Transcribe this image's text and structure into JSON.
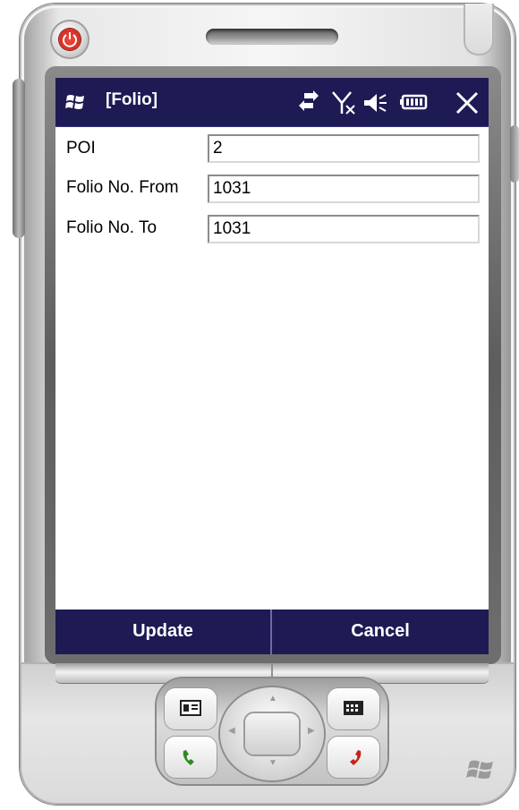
{
  "window": {
    "title": "[Folio]"
  },
  "status_icons": [
    "windows-start-icon",
    "sync-icon",
    "signal-off-icon",
    "volume-icon",
    "battery-icon",
    "close-icon"
  ],
  "form": {
    "poi": {
      "label": "POI",
      "value": "2"
    },
    "folio_from": {
      "label": "Folio No. From",
      "value": "1031"
    },
    "folio_to": {
      "label": "Folio No. To",
      "value": "1031"
    }
  },
  "softkeys": {
    "left": "Update",
    "right": "Cancel"
  },
  "hardware_keys": [
    "power-icon",
    "contacts-icon",
    "calendar-icon",
    "call-icon",
    "end-call-icon",
    "dpad",
    "windows-logo-icon"
  ],
  "colors": {
    "titlebar": "#1d1a54",
    "power": "#d9281e",
    "call_green": "#2e8a1f",
    "end_red": "#c92219"
  }
}
